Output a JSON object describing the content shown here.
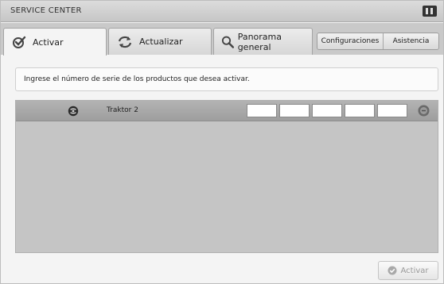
{
  "window": {
    "title": "SERVICE CENTER",
    "logo_icon": "native-instruments-logo-icon"
  },
  "tabs": [
    {
      "label": "Activar",
      "icon": "checkmark-icon",
      "active": true
    },
    {
      "label": "Actualizar",
      "icon": "refresh-icon",
      "active": false
    },
    {
      "label": "Panorama general",
      "icon": "magnifier-icon",
      "active": false
    }
  ],
  "header_buttons": {
    "settings_label": "Configuraciones",
    "help_label": "Asistencia"
  },
  "instruction": "Ingrese el número de serie de los productos que desea activar.",
  "product": {
    "name": "Traktor 2",
    "icon": "traktor-product-icon",
    "serial_values": [
      "",
      "",
      "",
      "",
      ""
    ],
    "status_icon": "status-circle-icon"
  },
  "footer": {
    "activate_label": "Activar",
    "activate_icon": "checkmark-icon"
  },
  "colors": {
    "window_bg": "#f4f4f4",
    "panel_bg": "#c5c5c5",
    "disabled_text": "#9a9a9a"
  }
}
